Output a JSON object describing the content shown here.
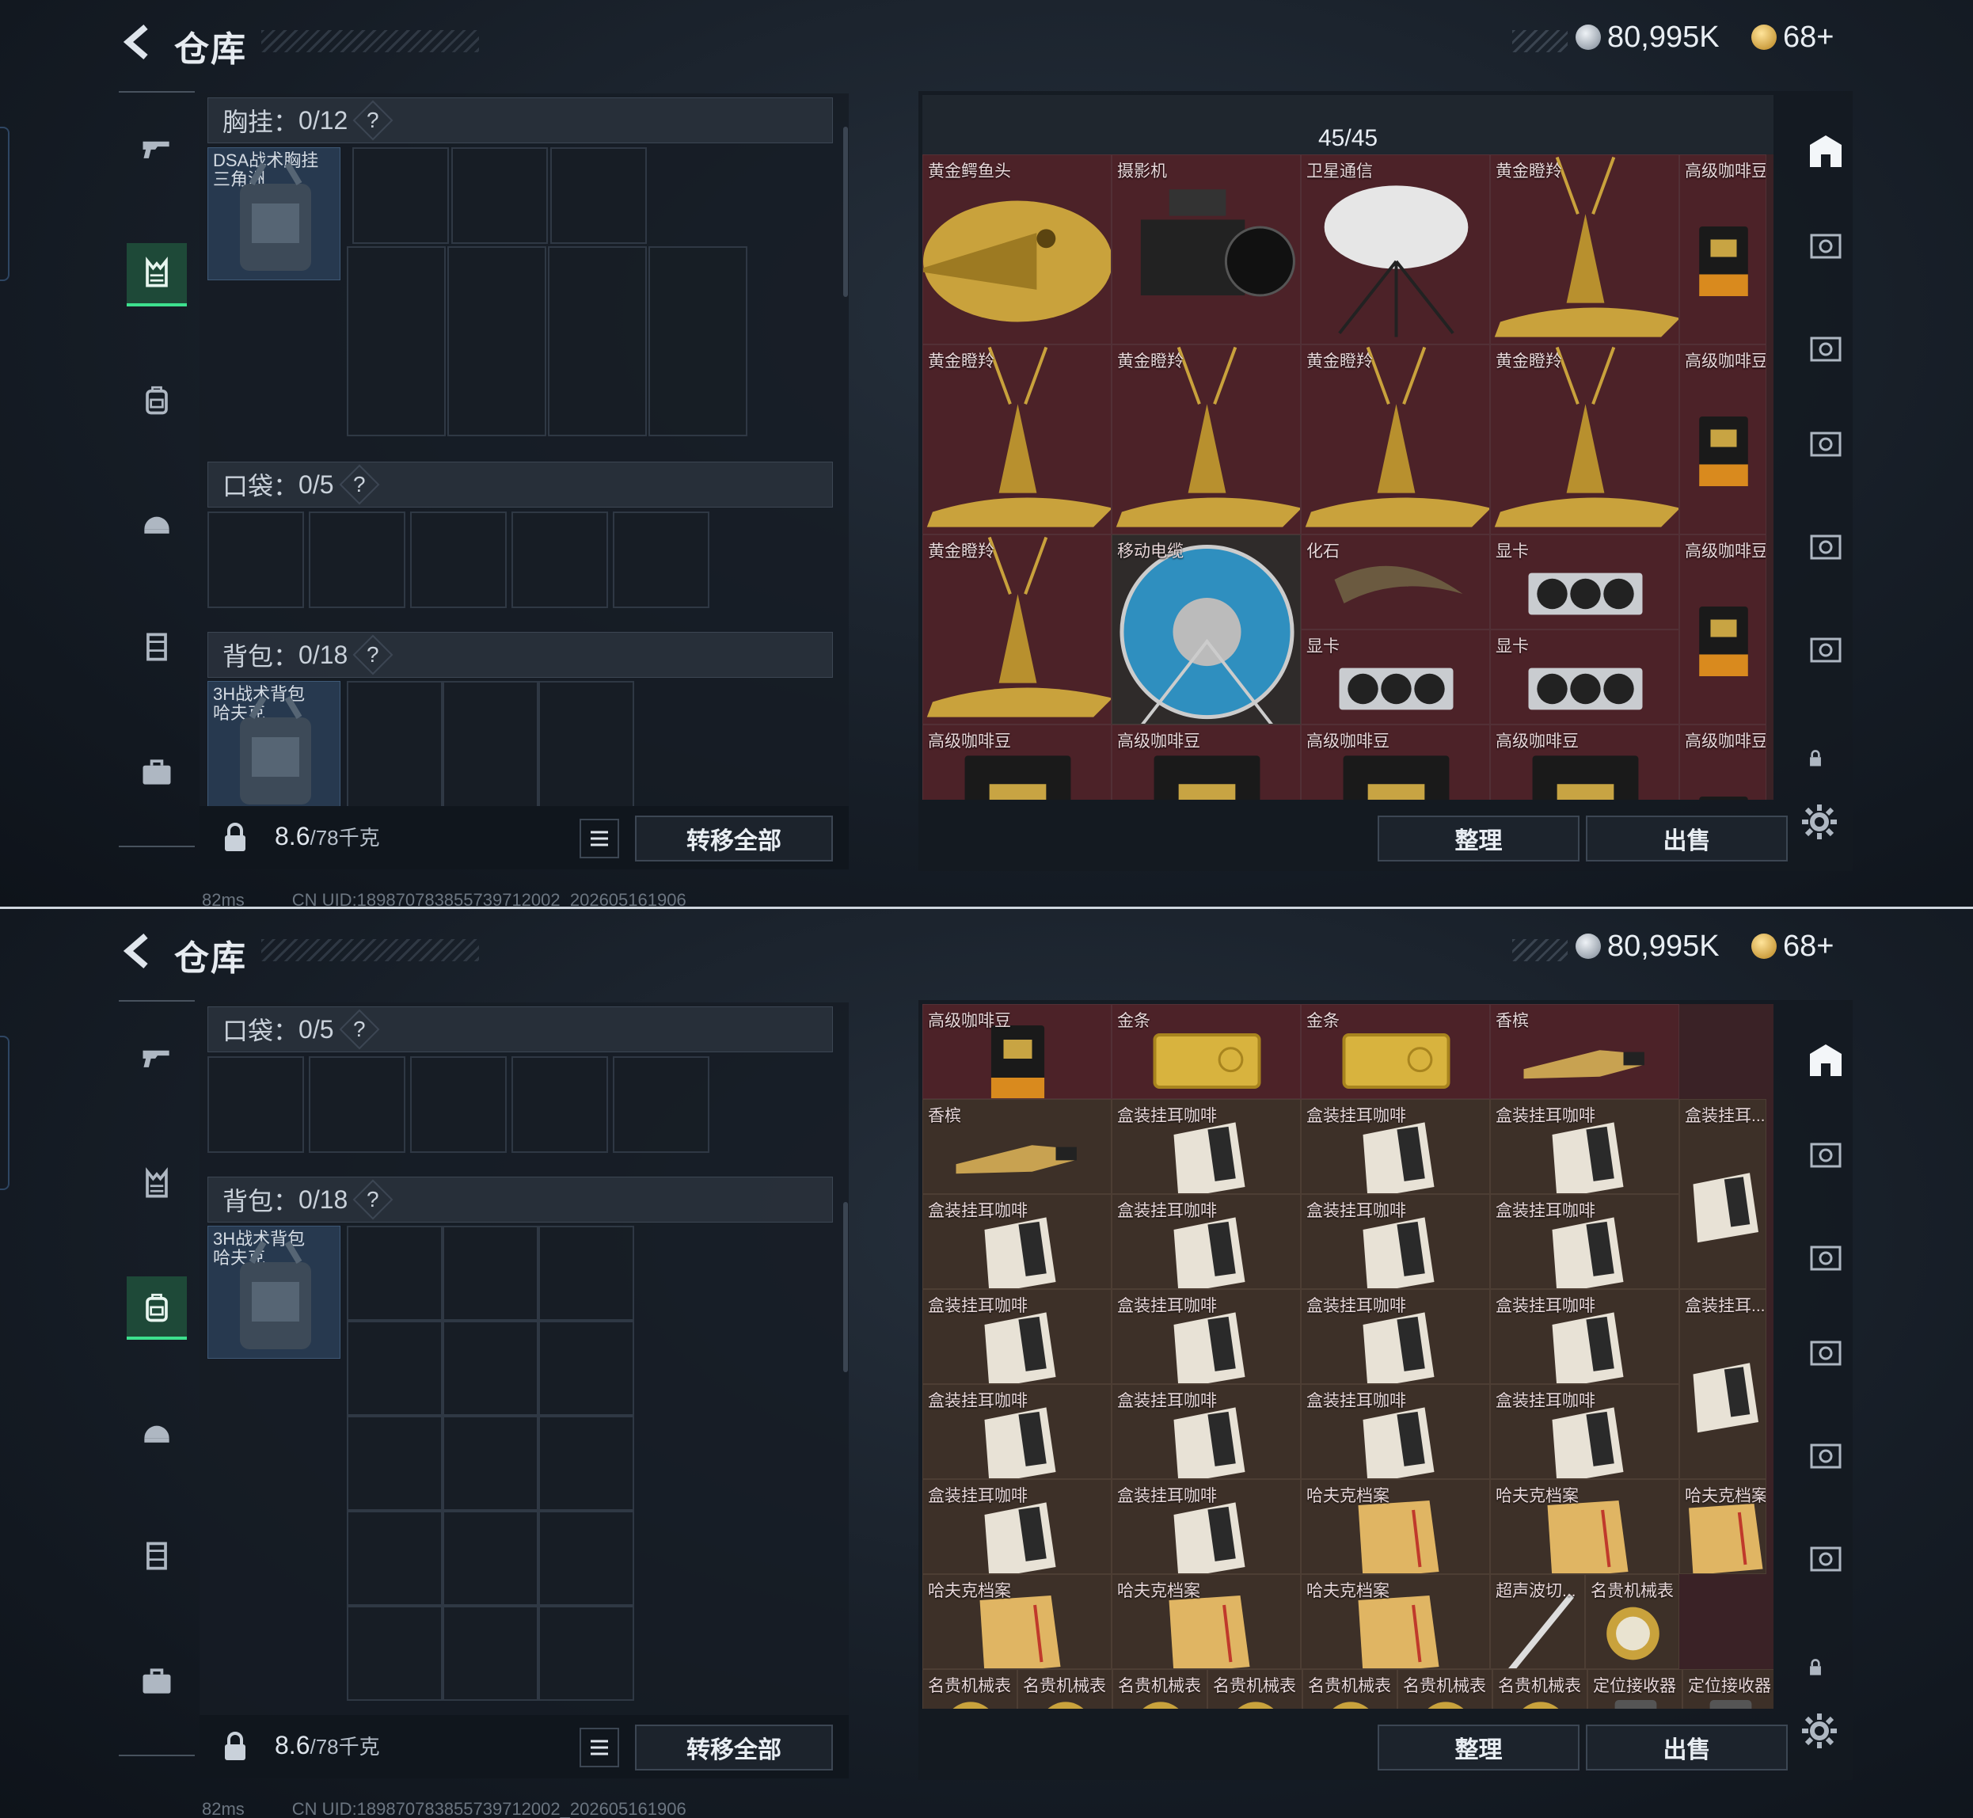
{
  "header": {
    "title": "仓库",
    "currency1": "80,995K",
    "currency2": "68+"
  },
  "footer": {
    "ping": "82ms",
    "uid": "CN UID:1898707838557397120​02_202605161906"
  },
  "weight": {
    "current": "8.6",
    "max": "/78千克"
  },
  "buttons": {
    "transfer_all": "转移全部",
    "sort": "整理",
    "sell": "出售"
  },
  "panel1": {
    "chest": {
      "label": "胸挂：",
      "count": "0/12",
      "help": "?",
      "item": "DSA战术胸挂\n三角洲"
    },
    "pocket": {
      "label": "口袋：",
      "count": "0/5",
      "help": "?"
    },
    "backpack": {
      "label": "背包：",
      "count": "0/18",
      "help": "?",
      "item": "3H战术背包\n哈夫克"
    },
    "stash_count": "45/45",
    "items": [
      {
        "name": "黄金鳄鱼头",
        "icon": "gold-crocodile-head"
      },
      {
        "name": "摄影机",
        "icon": "camera"
      },
      {
        "name": "卫星通信",
        "icon": "satellite-dish"
      },
      {
        "name": "黄金瞪羚",
        "icon": "gold-gazelle"
      },
      {
        "name": "高级咖啡豆",
        "icon": "coffee-bag"
      },
      {
        "name": "黄金瞪羚",
        "icon": "gold-gazelle"
      },
      {
        "name": "黄金瞪羚",
        "icon": "gold-gazelle"
      },
      {
        "name": "黄金瞪羚",
        "icon": "gold-gazelle"
      },
      {
        "name": "黄金瞪羚",
        "icon": "gold-gazelle"
      },
      {
        "name": "高级咖啡豆",
        "icon": "coffee-bag"
      },
      {
        "name": "黄金瞪羚",
        "icon": "gold-gazelle"
      },
      {
        "name": "移动电缆",
        "icon": "cable-reel"
      },
      {
        "name": "化石",
        "icon": "fossil"
      },
      {
        "name": "显卡",
        "icon": "gpu"
      },
      {
        "name": "高级咖啡豆",
        "icon": "coffee-bag"
      },
      {
        "name": "显卡",
        "icon": "gpu"
      },
      {
        "name": "显卡",
        "icon": "gpu"
      },
      {
        "name": "高级咖啡豆",
        "icon": "coffee-bag"
      },
      {
        "name": "高级咖啡豆",
        "icon": "coffee-bag"
      },
      {
        "name": "高级咖啡豆",
        "icon": "coffee-bag"
      },
      {
        "name": "高级咖啡豆",
        "icon": "coffee-bag"
      },
      {
        "name": "高级咖啡豆",
        "icon": "coffee-bag"
      }
    ]
  },
  "panel2": {
    "pocket": {
      "label": "口袋：",
      "count": "0/5",
      "help": "?"
    },
    "backpack": {
      "label": "背包：",
      "count": "0/18",
      "help": "?",
      "item": "3H战术背包\n哈夫克"
    },
    "items": [
      {
        "name": "高级咖啡豆",
        "icon": "coffee-bag"
      },
      {
        "name": "金条",
        "icon": "gold-bar"
      },
      {
        "name": "金条",
        "icon": "gold-bar"
      },
      {
        "name": "香槟",
        "icon": "champagne"
      },
      {
        "name": "香槟",
        "icon": "champagne"
      },
      {
        "name": "盒装挂耳咖啡",
        "icon": "coffee-box"
      },
      {
        "name": "盒装挂耳咖啡",
        "icon": "coffee-box"
      },
      {
        "name": "盒装挂耳咖啡",
        "icon": "coffee-box"
      },
      {
        "name": "盒装挂耳...",
        "icon": "coffee-box"
      },
      {
        "name": "盒装挂耳咖啡",
        "icon": "coffee-box"
      },
      {
        "name": "盒装挂耳咖啡",
        "icon": "coffee-box"
      },
      {
        "name": "盒装挂耳咖啡",
        "icon": "coffee-box"
      },
      {
        "name": "盒装挂耳咖啡",
        "icon": "coffee-box"
      },
      {
        "name": "盒装挂耳咖啡",
        "icon": "coffee-box"
      },
      {
        "name": "盒装挂耳咖啡",
        "icon": "coffee-box"
      },
      {
        "name": "盒装挂耳咖啡",
        "icon": "coffee-box"
      },
      {
        "name": "盒装挂耳咖啡",
        "icon": "coffee-box"
      },
      {
        "name": "盒装挂耳...",
        "icon": "coffee-box"
      },
      {
        "name": "盒装挂耳咖啡",
        "icon": "coffee-box"
      },
      {
        "name": "盒装挂耳咖啡",
        "icon": "coffee-box"
      },
      {
        "name": "盒装挂耳咖啡",
        "icon": "coffee-box"
      },
      {
        "name": "盒装挂耳咖啡",
        "icon": "coffee-box"
      },
      {
        "name": "盒装挂耳咖啡",
        "icon": "coffee-box"
      },
      {
        "name": "盒装挂耳咖啡",
        "icon": "coffee-box"
      },
      {
        "name": "哈夫克档案",
        "icon": "document-folder"
      },
      {
        "name": "哈夫克档案",
        "icon": "document-folder"
      },
      {
        "name": "哈夫克档案",
        "icon": "document-folder"
      },
      {
        "name": "哈夫克档案",
        "icon": "document-folder"
      },
      {
        "name": "哈夫克档案",
        "icon": "document-folder"
      },
      {
        "name": "哈夫克档案",
        "icon": "document-folder"
      },
      {
        "name": "超声波切...",
        "icon": "ultrasonic-cutter"
      },
      {
        "name": "名贵机械表",
        "icon": "watch"
      },
      {
        "name": "名贵机械表",
        "icon": "watch"
      },
      {
        "name": "名贵机械表",
        "icon": "watch"
      },
      {
        "name": "名贵机械表",
        "icon": "watch"
      },
      {
        "name": "名贵机械表",
        "icon": "watch"
      },
      {
        "name": "名贵机械表",
        "icon": "watch"
      },
      {
        "name": "名贵机械表",
        "icon": "watch"
      },
      {
        "name": "名贵机械表",
        "icon": "watch"
      },
      {
        "name": "定位接收器",
        "icon": "locator-receiver"
      },
      {
        "name": "定位接收器",
        "icon": "locator-receiver"
      }
    ]
  }
}
